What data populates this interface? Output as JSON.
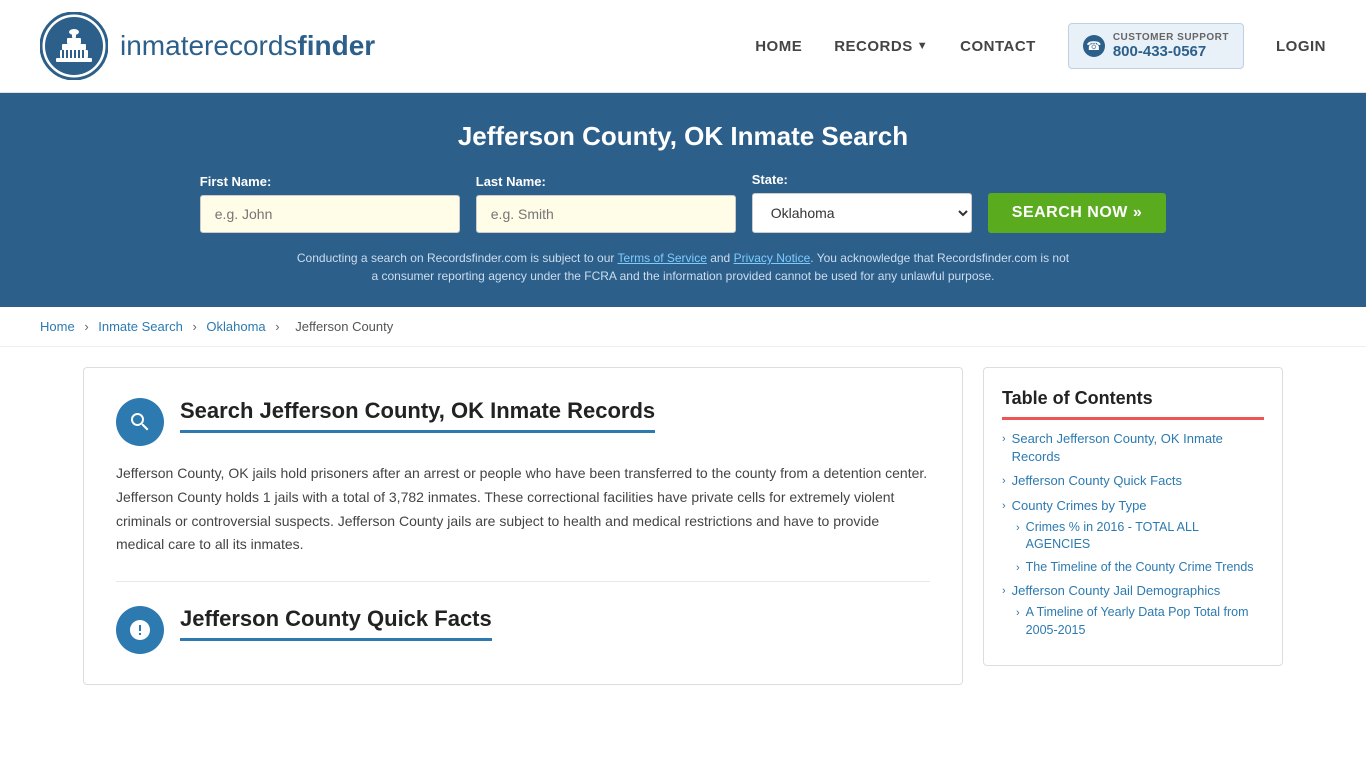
{
  "header": {
    "logo_text_normal": "inmaterecords",
    "logo_text_bold": "finder",
    "nav": {
      "home": "HOME",
      "records": "RECORDS",
      "contact": "CONTACT",
      "login": "LOGIN"
    },
    "support": {
      "label": "CUSTOMER SUPPORT",
      "number": "800-433-0567"
    }
  },
  "banner": {
    "title": "Jefferson County, OK Inmate Search",
    "first_name_label": "First Name:",
    "first_name_placeholder": "e.g. John",
    "last_name_label": "Last Name:",
    "last_name_placeholder": "e.g. Smith",
    "state_label": "State:",
    "state_value": "Oklahoma",
    "search_button": "SEARCH NOW »",
    "disclaimer": "Conducting a search on Recordsfinder.com is subject to our Terms of Service and Privacy Notice. You acknowledge that Recordsfinder.com is not a consumer reporting agency under the FCRA and the information provided cannot be used for any unlawful purpose.",
    "terms_link": "Terms of Service",
    "privacy_link": "Privacy Notice"
  },
  "breadcrumb": {
    "home": "Home",
    "inmate_search": "Inmate Search",
    "state": "Oklahoma",
    "county": "Jefferson County"
  },
  "main": {
    "section1": {
      "title": "Search Jefferson County, OK Inmate Records",
      "body": "Jefferson County, OK jails hold prisoners after an arrest or people who have been transferred to the county from a detention center. Jefferson County holds 1 jails with a total of 3,782 inmates. These correctional facilities have private cells for extremely violent criminals or controversial suspects. Jefferson County jails are subject to health and medical restrictions and have to provide medical care to all its inmates."
    },
    "section2": {
      "title": "Jefferson County Quick Facts"
    }
  },
  "toc": {
    "title": "Table of Contents",
    "items": [
      {
        "label": "Search Jefferson County, OK Inmate Records",
        "sub": []
      },
      {
        "label": "Jefferson County Quick Facts",
        "sub": []
      },
      {
        "label": "County Crimes by Type",
        "sub": [
          "Crimes % in 2016 - TOTAL ALL AGENCIES",
          "The Timeline of the County Crime Trends"
        ]
      },
      {
        "label": "Jefferson County Jail Demographics",
        "sub": [
          "A Timeline of Yearly Data Pop Total from 2005-2015"
        ]
      }
    ]
  }
}
